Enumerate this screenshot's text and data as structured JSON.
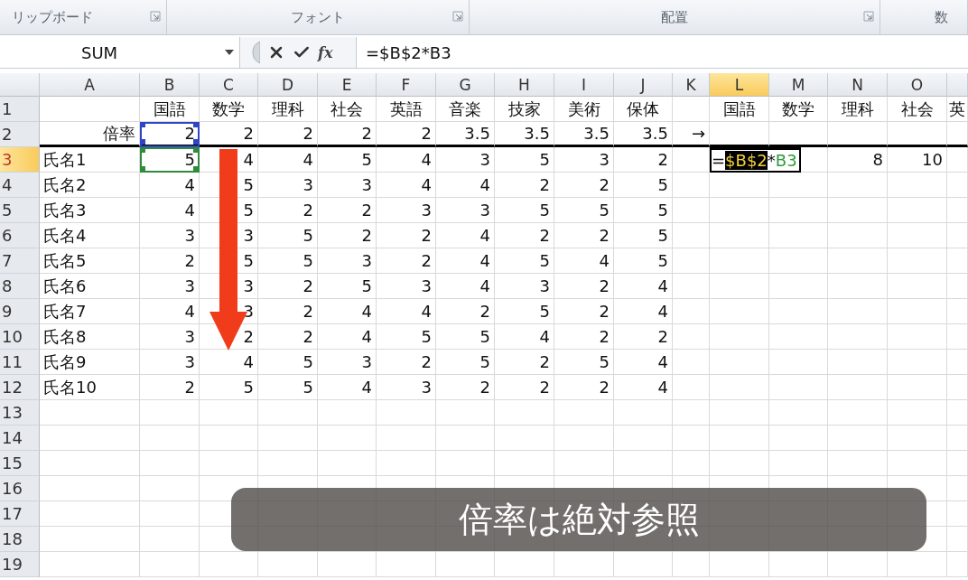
{
  "ribbon_groups": [
    {
      "label": "リップボード",
      "launcher": true
    },
    {
      "label": "フォント",
      "launcher": true
    },
    {
      "label": "配置",
      "launcher": true
    },
    {
      "label": "数",
      "launcher": false
    }
  ],
  "formula_bar": {
    "name_box": "SUM",
    "function_label": "fx",
    "formula": "=$B$2*B3"
  },
  "columns": [
    {
      "label": "A",
      "selected": false
    },
    {
      "label": "B",
      "selected": false
    },
    {
      "label": "C",
      "selected": false
    },
    {
      "label": "D",
      "selected": false
    },
    {
      "label": "E",
      "selected": false
    },
    {
      "label": "F",
      "selected": false
    },
    {
      "label": "G",
      "selected": false
    },
    {
      "label": "H",
      "selected": false
    },
    {
      "label": "I",
      "selected": false
    },
    {
      "label": "J",
      "selected": false
    },
    {
      "label": "K",
      "selected": false
    },
    {
      "label": "L",
      "selected": true
    },
    {
      "label": "M",
      "selected": false
    },
    {
      "label": "N",
      "selected": false
    },
    {
      "label": "O",
      "selected": false
    }
  ],
  "rows": [
    {
      "number": "1",
      "selected": false,
      "kind": "heading",
      "cells": [
        null,
        "国語",
        "数学",
        "理科",
        "社会",
        "英語",
        "音楽",
        "技家",
        "美術",
        "保体",
        null,
        "国語",
        "数学",
        "理科",
        "社会",
        "英"
      ]
    },
    {
      "number": "2",
      "selected": false,
      "kind": "values",
      "cells": [
        "倍率",
        {
          "text": "2",
          "color": "#2f45c4"
        },
        "2",
        "2",
        "2",
        "2",
        "3.5",
        "3.5",
        "3.5",
        "3.5",
        "→"
      ]
    },
    {
      "number": "3",
      "selected": true,
      "kind": "records",
      "cells": [
        "氏名1",
        {
          "text": "5",
          "color": "#2e8b3a"
        },
        "4",
        "4",
        "5",
        "4",
        "3",
        "5",
        "3",
        "2",
        null,
        {
          "kind": "formula-edit",
          "parts": [
            {
              "text": "=",
              "kind": "plain"
            },
            {
              "text": "$B$2",
              "kind": "ref-selected"
            },
            {
              "text": "*",
              "kind": "plain"
            },
            {
              "text": "B3",
              "kind": "ref"
            }
          ]
        },
        null,
        "8",
        "10"
      ]
    },
    {
      "number": "4",
      "selected": false,
      "kind": "records",
      "cells": [
        "氏名2",
        "4",
        "5",
        "3",
        "3",
        "4",
        "4",
        "2",
        "2",
        "5"
      ]
    },
    {
      "number": "5",
      "selected": false,
      "kind": "records",
      "cells": [
        "氏名3",
        "4",
        "5",
        "2",
        "2",
        "3",
        "3",
        "5",
        "5",
        "5"
      ]
    },
    {
      "number": "6",
      "selected": false,
      "kind": "records",
      "cells": [
        "氏名4",
        "3",
        "3",
        "5",
        "2",
        "2",
        "4",
        "2",
        "2",
        "5"
      ]
    },
    {
      "number": "7",
      "selected": false,
      "kind": "records",
      "cells": [
        "氏名5",
        "2",
        "5",
        "5",
        "3",
        "2",
        "4",
        "5",
        "4",
        "5"
      ]
    },
    {
      "number": "8",
      "selected": false,
      "kind": "records",
      "cells": [
        "氏名6",
        "3",
        "3",
        "2",
        "5",
        "3",
        "4",
        "3",
        "2",
        "4"
      ]
    },
    {
      "number": "9",
      "selected": false,
      "kind": "records",
      "cells": [
        "氏名7",
        "4",
        "3",
        "2",
        "4",
        "4",
        "2",
        "5",
        "2",
        "4"
      ]
    },
    {
      "number": "10",
      "selected": false,
      "kind": "records",
      "cells": [
        "氏名8",
        "3",
        "2",
        "2",
        "4",
        "5",
        "5",
        "4",
        "2",
        "2"
      ]
    },
    {
      "number": "11",
      "selected": false,
      "kind": "records",
      "cells": [
        "氏名9",
        "3",
        "4",
        "5",
        "3",
        "2",
        "5",
        "2",
        "5",
        "4"
      ]
    },
    {
      "number": "12",
      "selected": false,
      "kind": "records",
      "cells": [
        "氏名10",
        "2",
        "5",
        "5",
        "4",
        "3",
        "2",
        "2",
        "2",
        "4"
      ]
    },
    {
      "number": "13",
      "selected": false,
      "kind": "records"
    },
    {
      "number": "14",
      "selected": false,
      "kind": "records"
    },
    {
      "number": "15",
      "selected": false,
      "kind": "records"
    },
    {
      "number": "16",
      "selected": false,
      "kind": "records"
    },
    {
      "number": "17",
      "selected": false,
      "kind": "records"
    },
    {
      "number": "18",
      "selected": false,
      "kind": "records"
    },
    {
      "number": "19",
      "selected": false,
      "kind": "records"
    }
  ],
  "caption": "倍率は絶対参照"
}
